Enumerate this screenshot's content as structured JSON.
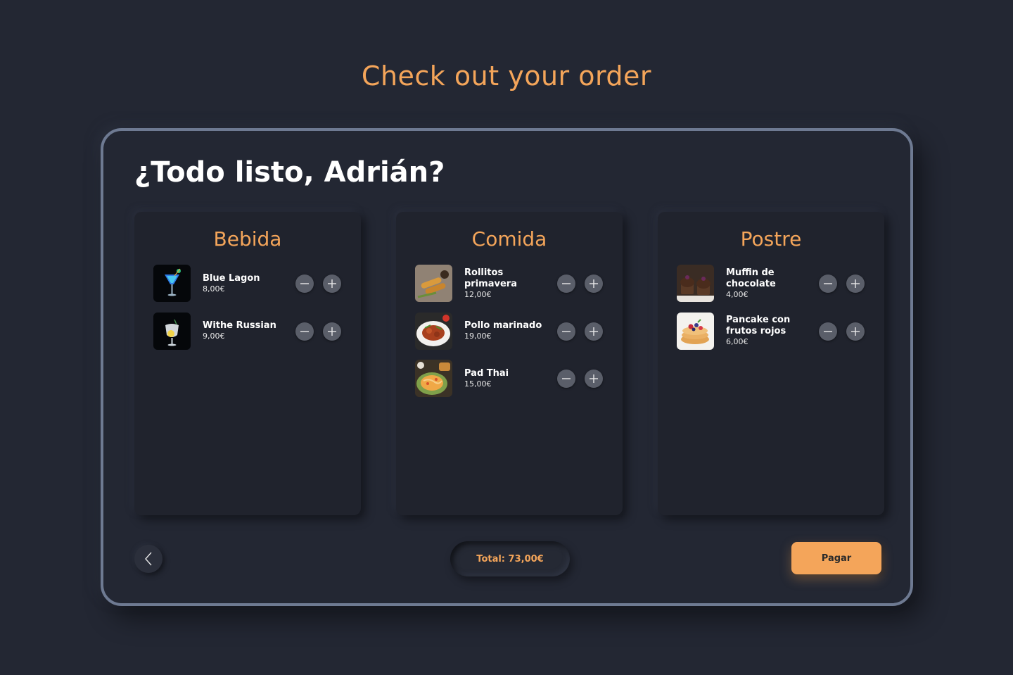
{
  "page_title": "Check out your order",
  "greeting": "¿Todo listo, Adrián?",
  "columns": [
    {
      "title": "Bebida",
      "items": [
        {
          "name": "Blue Lagon",
          "price": "8,00€",
          "image": "blue-cocktail-image"
        },
        {
          "name": "Withe Russian",
          "price": "9,00€",
          "image": "white-cocktail-image"
        }
      ]
    },
    {
      "title": "Comida",
      "items": [
        {
          "name": "Rollitos primavera",
          "price": "12,00€",
          "image": "spring-rolls-image"
        },
        {
          "name": "Pollo marinado",
          "price": "19,00€",
          "image": "marinated-chicken-image"
        },
        {
          "name": "Pad Thai",
          "price": "15,00€",
          "image": "pad-thai-image"
        }
      ]
    },
    {
      "title": "Postre",
      "items": [
        {
          "name": "Muffin de chocolate",
          "price": "4,00€",
          "image": "chocolate-muffin-image"
        },
        {
          "name": "Pancake con frutos rojos",
          "price": "6,00€",
          "image": "berry-pancake-image"
        }
      ]
    }
  ],
  "footer": {
    "total_label": "Total: 73,00€",
    "pay_label": "Pagar"
  },
  "icons": {
    "back": "chevron-left-icon",
    "decrease": "minus-icon",
    "increase": "plus-icon"
  },
  "colors": {
    "background": "#232733",
    "accent": "#f4a55a",
    "frame_border": "#6e7a92",
    "card": "#20232d",
    "qty_button": "#5a5e69"
  }
}
